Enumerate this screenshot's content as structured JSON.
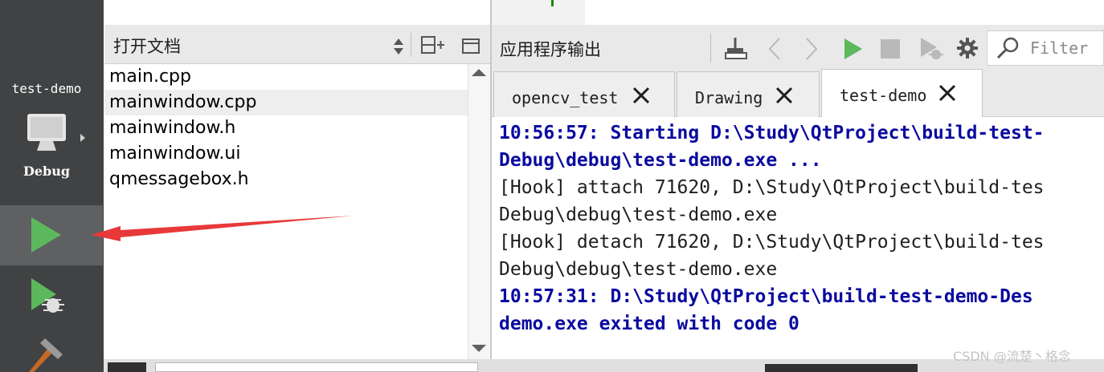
{
  "mode_bar": {
    "kit_name": "test-demo",
    "build_config": "Debug"
  },
  "open_documents": {
    "title": "打开文档",
    "files": [
      {
        "name": "main.cpp",
        "selected": false
      },
      {
        "name": "mainwindow.cpp",
        "selected": true
      },
      {
        "name": "mainwindow.h",
        "selected": false
      },
      {
        "name": "mainwindow.ui",
        "selected": false
      },
      {
        "name": "qmessagebox.h",
        "selected": false
      }
    ]
  },
  "output_pane": {
    "title": "应用程序输出",
    "filter_placeholder": "Filter",
    "tabs": [
      {
        "label": "opencv_test",
        "active": false
      },
      {
        "label": "Drawing",
        "active": false
      },
      {
        "label": "test-demo",
        "active": true
      }
    ],
    "lines": [
      {
        "text": "10:56:57: Starting D:\\Study\\QtProject\\build-test-",
        "style": "blue"
      },
      {
        "text": "Debug\\debug\\test-demo.exe ...",
        "style": "blue"
      },
      {
        "text": "[Hook] attach 71620, D:\\Study\\QtProject\\build-tes",
        "style": "plain"
      },
      {
        "text": "Debug\\debug\\test-demo.exe",
        "style": "plain"
      },
      {
        "text": "[Hook] detach 71620, D:\\Study\\QtProject\\build-tes",
        "style": "plain"
      },
      {
        "text": "Debug\\debug\\test-demo.exe",
        "style": "plain"
      },
      {
        "text": "10:57:31: D:\\Study\\QtProject\\build-test-demo-Des",
        "style": "blue"
      },
      {
        "text": "demo.exe exited with code 0",
        "style": "blue"
      }
    ]
  },
  "watermark": "CSDN @流楚丶格念",
  "icons": [
    "monitor-icon",
    "run-icon",
    "debug-run-icon",
    "build-hammer-icon",
    "sort-updown-icon",
    "split-add-icon",
    "close-pane-icon",
    "clean-output-icon",
    "prev-icon",
    "next-icon",
    "rerun-icon",
    "stop-icon",
    "attach-debugger-icon",
    "gear-icon",
    "search-icon",
    "close-tab-icon"
  ],
  "colors": {
    "mode_bar": "#404244",
    "run_green": "#5cb85c",
    "output_blue": "#0a0aa0",
    "annotation_red": "#e8393a"
  }
}
